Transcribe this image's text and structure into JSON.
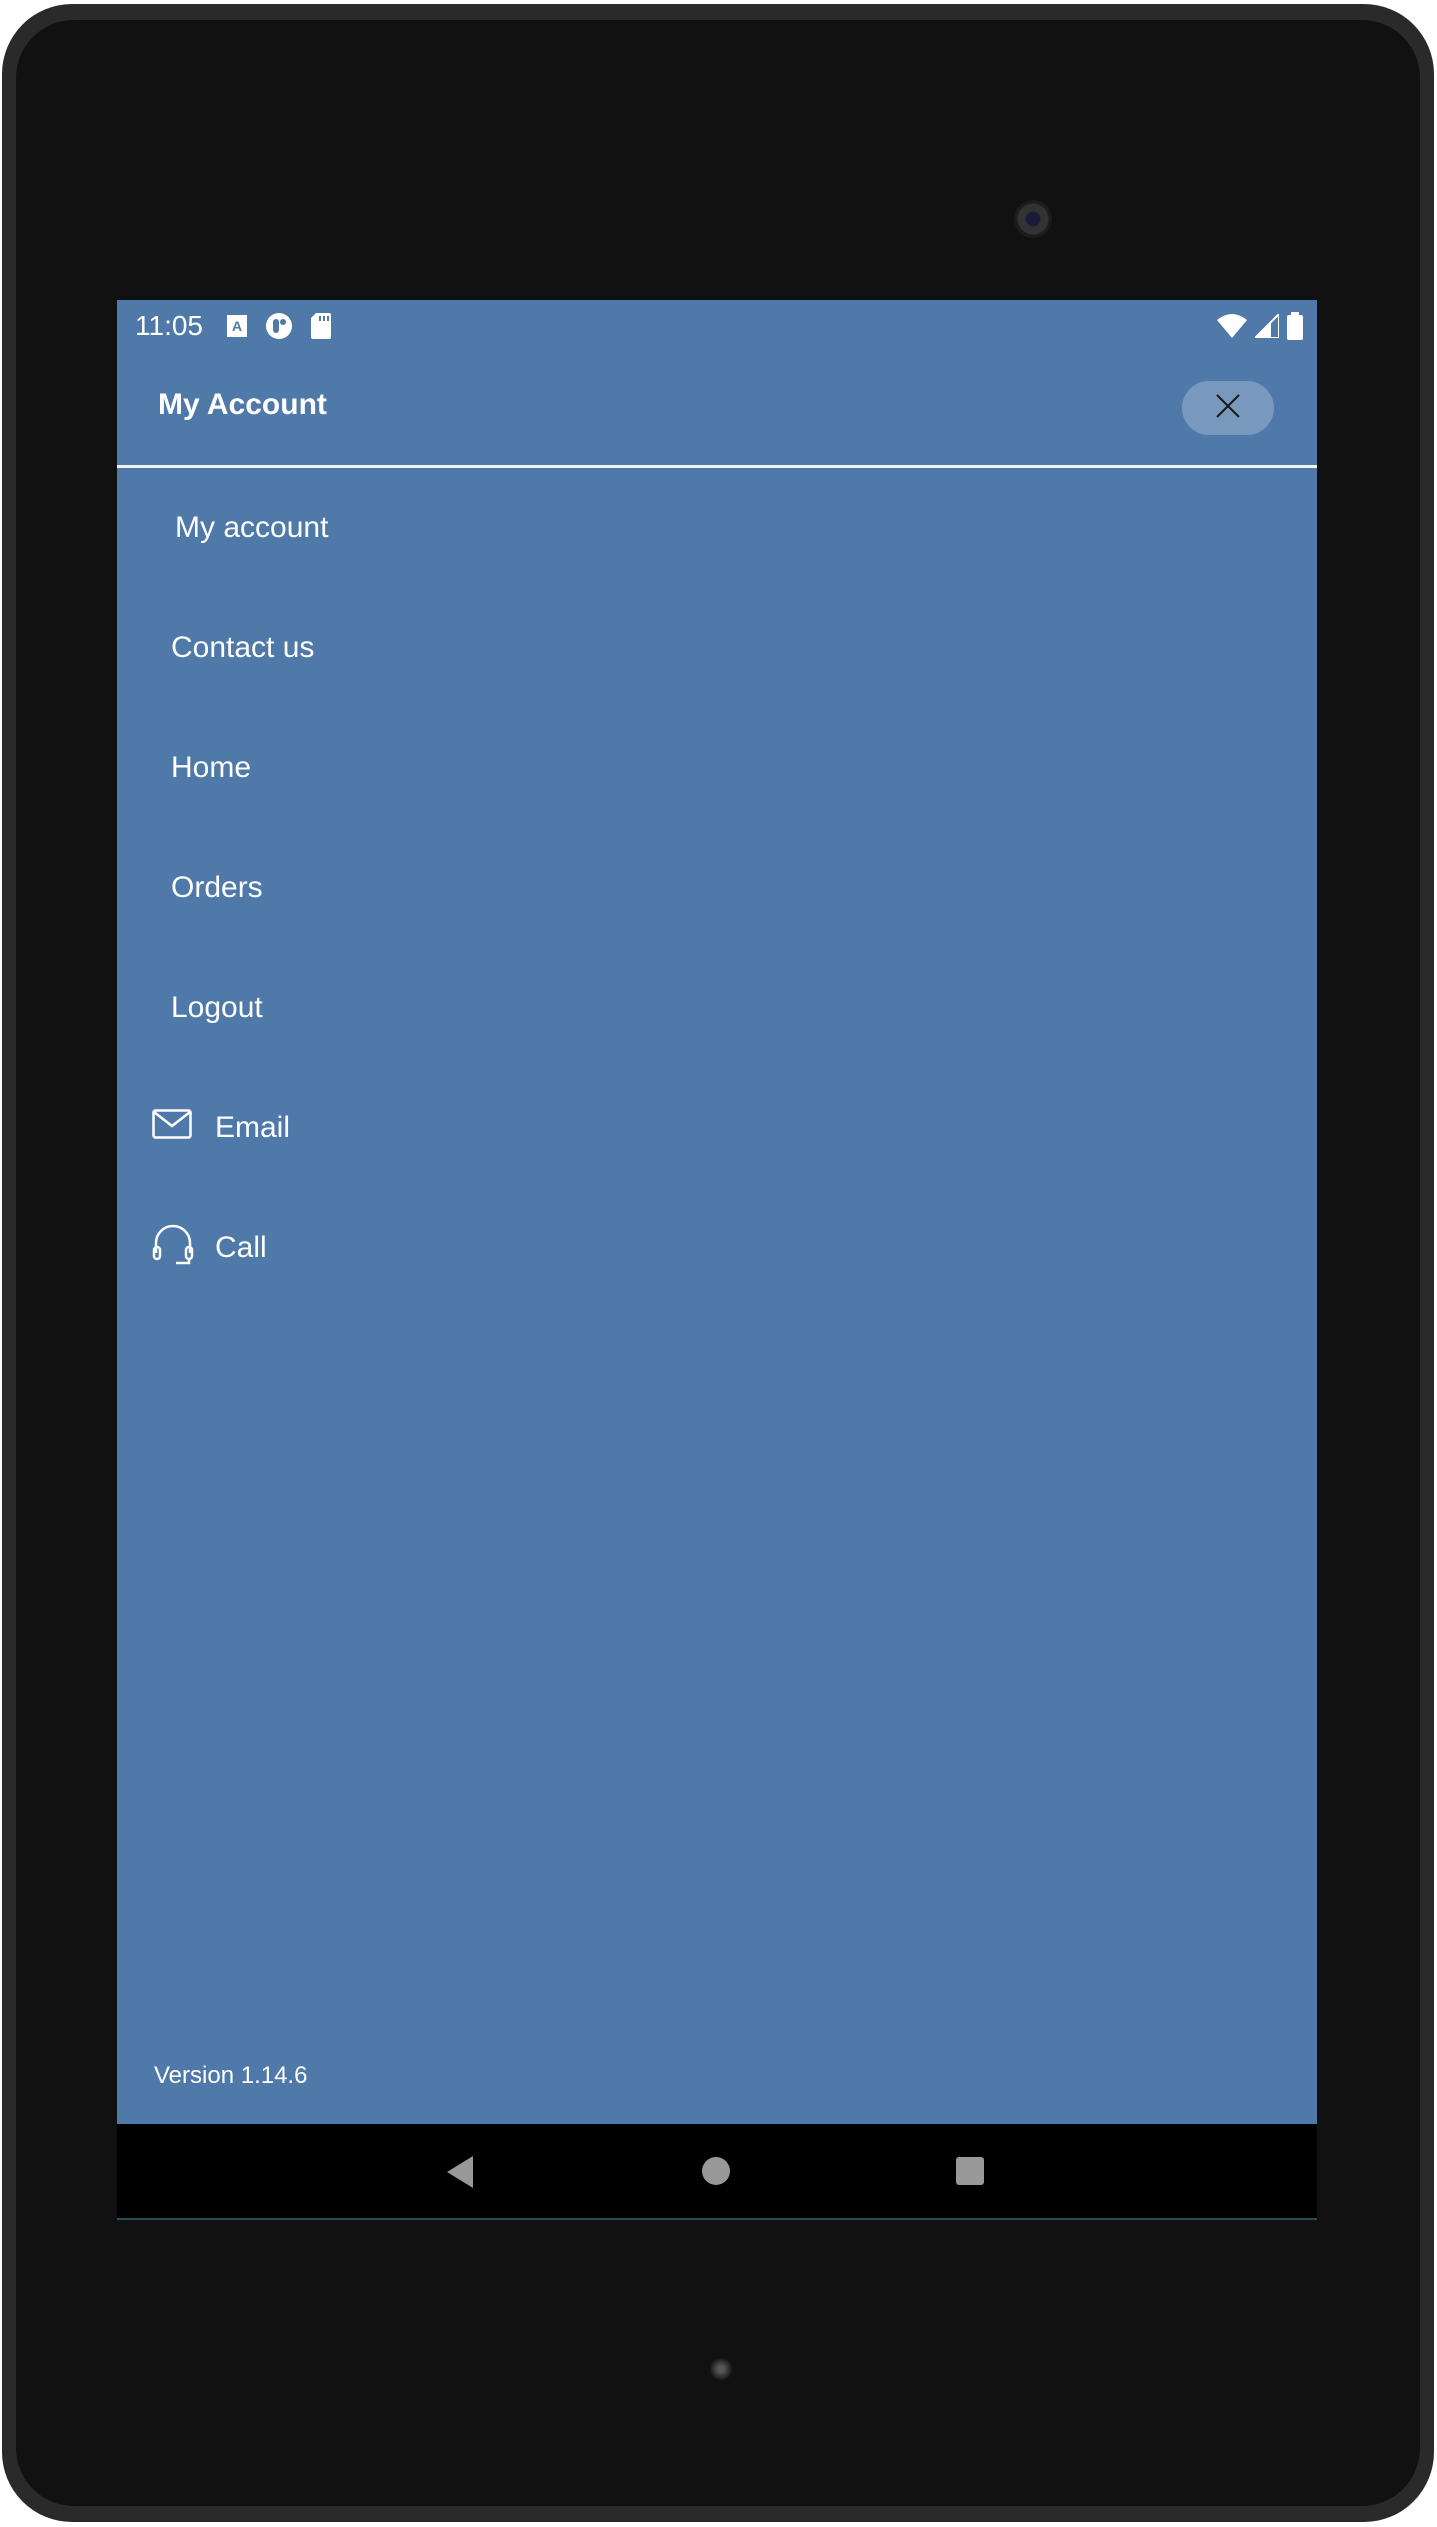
{
  "status_bar": {
    "time": "11:05",
    "left_icons": [
      "keyboard-a-icon",
      "app-circle-icon",
      "sd-card-icon"
    ],
    "right_icons": [
      "wifi-icon",
      "cell-signal-icon",
      "battery-icon"
    ]
  },
  "header": {
    "title": "My Account",
    "close_icon": "close-icon"
  },
  "menu": {
    "items": [
      {
        "label": "My account",
        "icon": null
      },
      {
        "label": "Contact us",
        "icon": null
      },
      {
        "label": "Home",
        "icon": null
      },
      {
        "label": "Orders",
        "icon": null
      },
      {
        "label": "Logout",
        "icon": null
      },
      {
        "label": "Email",
        "icon": "envelope-icon"
      },
      {
        "label": "Call",
        "icon": "headset-icon"
      }
    ]
  },
  "footer": {
    "version": "Version 1.14.6"
  },
  "nav_bar": {
    "buttons": [
      "back-icon",
      "home-icon",
      "recents-icon"
    ]
  },
  "colors": {
    "background": "#4f79a8",
    "close_button": "#7899bd",
    "text": "#ffffff",
    "divider": "#eef4f4"
  }
}
